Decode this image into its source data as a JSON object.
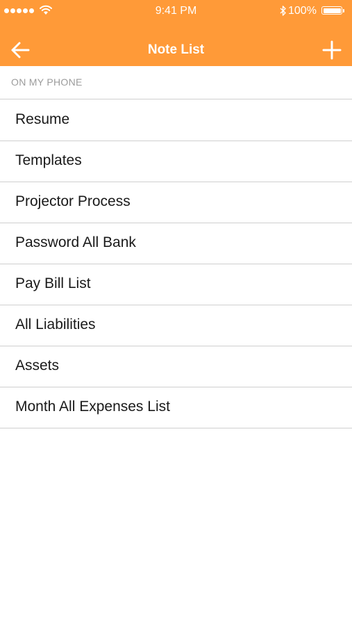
{
  "status_bar": {
    "time": "9:41 PM",
    "battery": "100%",
    "icons": [
      "signal-dots-icon",
      "wifi-icon",
      "bluetooth-icon",
      "battery-icon"
    ]
  },
  "nav": {
    "title": "Note List",
    "back_icon": "arrow-left-icon",
    "add_icon": "plus-icon"
  },
  "section": {
    "header": "ON MY PHONE"
  },
  "notes": [
    {
      "label": "Resume"
    },
    {
      "label": "Templates"
    },
    {
      "label": "Projector Process"
    },
    {
      "label": "Password All Bank"
    },
    {
      "label": "Pay Bill List"
    },
    {
      "label": "All Liabilities"
    },
    {
      "label": "Assets"
    },
    {
      "label": "Month All Expenses List"
    }
  ],
  "colors": {
    "accent": "#FF9A38",
    "background": "#FFFFFF",
    "divider": "#CFCFCF",
    "section_text": "#9B9B9B",
    "item_text": "#1A1A1A"
  }
}
